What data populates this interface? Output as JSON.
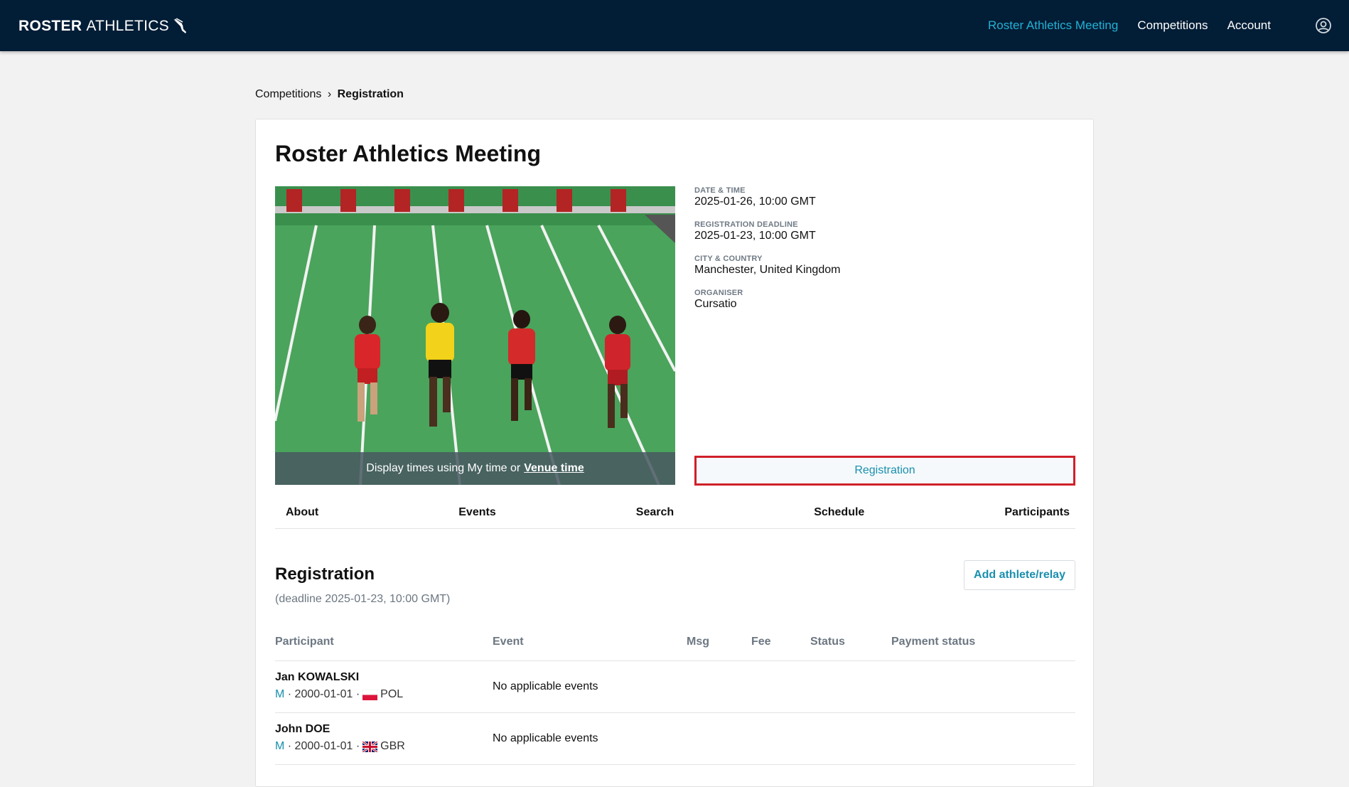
{
  "brand": {
    "bold": "ROSTER",
    "light": "ATHLETICS"
  },
  "nav": {
    "items": [
      {
        "label": "Roster Athletics Meeting",
        "active": true
      },
      {
        "label": "Competitions",
        "active": false
      },
      {
        "label": "Account",
        "active": false
      }
    ],
    "user_icon": "user-circle-icon"
  },
  "breadcrumb": {
    "parent": "Competitions",
    "separator": "›",
    "current": "Registration"
  },
  "competition": {
    "title": "Roster Athletics Meeting",
    "hero_caption": {
      "prefix": "Display times using My time or",
      "link": "Venue time"
    },
    "info": [
      {
        "label": "DATE & TIME",
        "value": "2025-01-26, 10:00 GMT"
      },
      {
        "label": "REGISTRATION DEADLINE",
        "value": "2025-01-23, 10:00 GMT"
      },
      {
        "label": "CITY & COUNTRY",
        "value": "Manchester, United Kingdom"
      },
      {
        "label": "ORGANISER",
        "value": "Cursatio"
      }
    ],
    "registration_button": "Registration"
  },
  "tabs": [
    "About",
    "Events",
    "Search",
    "Schedule",
    "Participants"
  ],
  "registration": {
    "title": "Registration",
    "deadline": "(deadline 2025-01-23, 10:00 GMT)",
    "add_button": "Add athlete/relay",
    "columns": [
      "Participant",
      "Event",
      "Msg",
      "Fee",
      "Status",
      "Payment status"
    ],
    "rows": [
      {
        "name": "Jan KOWALSKI",
        "gender": "M",
        "dob": "2000-01-01",
        "country": "POL",
        "flag": "pl",
        "event": "No applicable events"
      },
      {
        "name": "John DOE",
        "gender": "M",
        "dob": "2000-01-01",
        "country": "GBR",
        "flag": "gb",
        "event": "No applicable events"
      }
    ]
  },
  "colors": {
    "navbar": "#021d36",
    "accent": "#23b1d4",
    "link": "#1a8fae",
    "highlight_border": "#d0202a"
  }
}
